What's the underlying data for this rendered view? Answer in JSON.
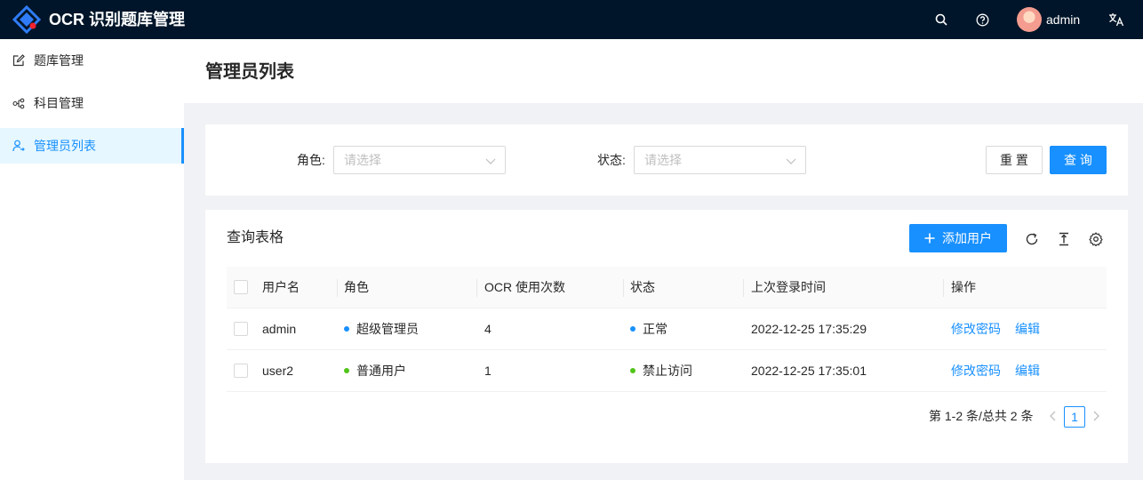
{
  "app": {
    "title": "OCR 识别题库管理",
    "username": "admin"
  },
  "colors": {
    "header_bg": "#001529",
    "primary": "#1890ff",
    "success": "#52c41a"
  },
  "sidebar": {
    "items": [
      {
        "label": "题库管理",
        "icon": "edit-icon",
        "active": false
      },
      {
        "label": "科目管理",
        "icon": "cluster-icon",
        "active": false
      },
      {
        "label": "管理员列表",
        "icon": "user-switch-icon",
        "active": true
      }
    ]
  },
  "page": {
    "title": "管理员列表"
  },
  "filters": {
    "role_label": "角色",
    "role_placeholder": "请选择",
    "status_label": "状态",
    "status_placeholder": "请选择",
    "reset_label": "重 置",
    "query_label": "查 询"
  },
  "table_card": {
    "title": "查询表格",
    "add_label": "添加用户",
    "columns": [
      "用户名",
      "角色",
      "OCR 使用次数",
      "状态",
      "上次登录时间",
      "操作"
    ],
    "rows": [
      {
        "username": "admin",
        "role": "超级管理员",
        "role_color": "#1890ff",
        "ocr_count": "4",
        "status": "正常",
        "status_color": "#1890ff",
        "last_login": "2022-12-25 17:35:29",
        "action1": "修改密码",
        "action2": "编辑"
      },
      {
        "username": "user2",
        "role": "普通用户",
        "role_color": "#52c41a",
        "ocr_count": "1",
        "status": "禁止访问",
        "status_color": "#52c41a",
        "last_login": "2022-12-25 17:35:01",
        "action1": "修改密码",
        "action2": "编辑"
      }
    ]
  },
  "pagination": {
    "summary": "第 1-2 条/总共 2 条",
    "current_page": "1"
  }
}
